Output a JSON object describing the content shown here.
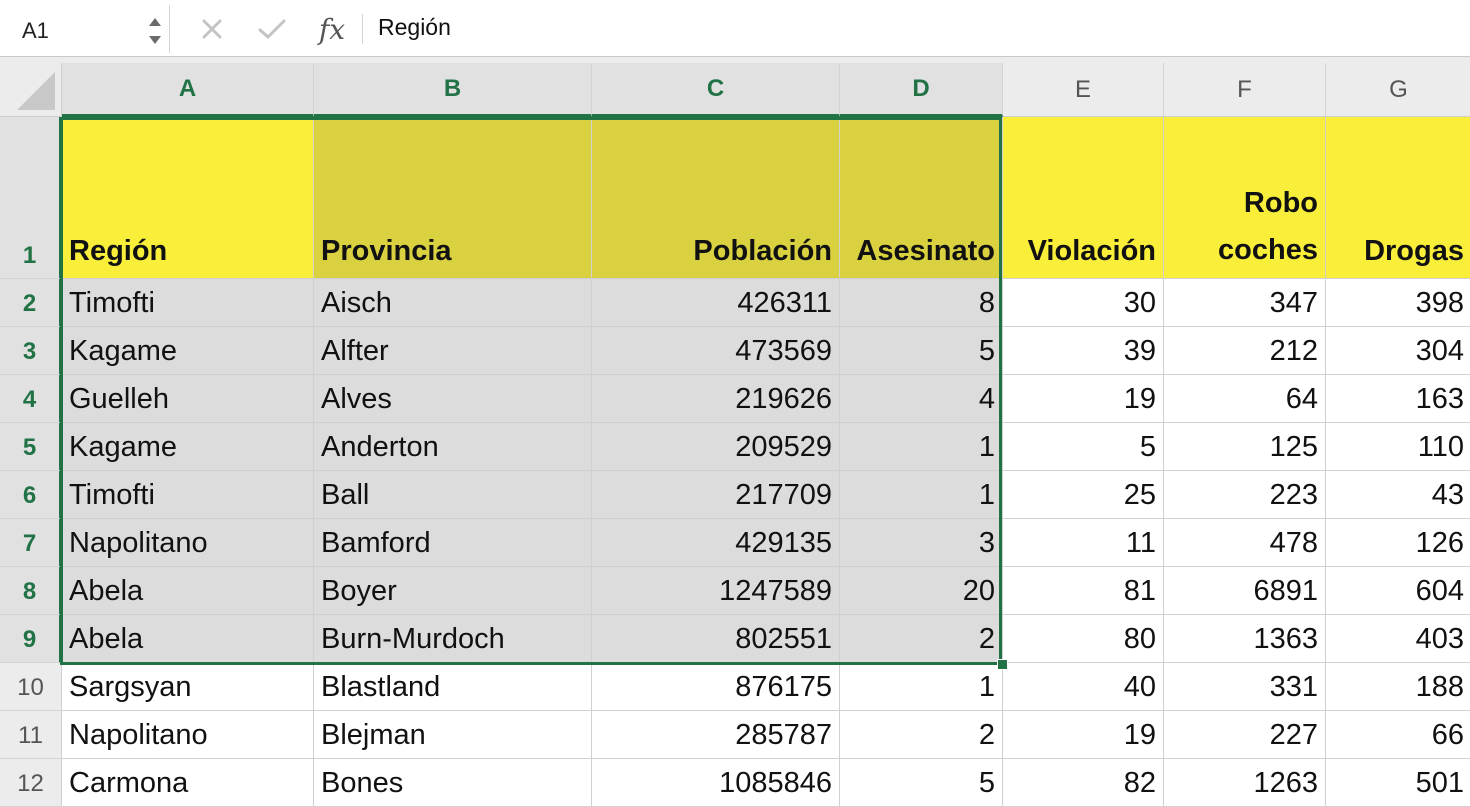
{
  "name_box": "A1",
  "formula": "Región",
  "formula_icons": {
    "cancel": "close-icon",
    "confirm": "check-icon",
    "function": "fx-icon"
  },
  "fx_label": "fx",
  "columns": [
    "A",
    "B",
    "C",
    "D",
    "E",
    "F",
    "G"
  ],
  "rows": [
    "1",
    "2",
    "3",
    "4",
    "5",
    "6",
    "7",
    "8",
    "9",
    "10",
    "11",
    "12"
  ],
  "selected_columns": [
    "A",
    "B",
    "C",
    "D"
  ],
  "selected_rows": [
    "1",
    "2",
    "3",
    "4",
    "5",
    "6",
    "7",
    "8",
    "9"
  ],
  "headers": [
    "Región",
    "Provincia",
    "Población",
    "Asesinato",
    "Violación",
    "Robo coches",
    "Drogas"
  ],
  "data": [
    [
      "Timofti",
      "Aisch",
      "426311",
      "8",
      "30",
      "347",
      "398"
    ],
    [
      "Kagame",
      "Alfter",
      "473569",
      "5",
      "39",
      "212",
      "304"
    ],
    [
      "Guelleh",
      "Alves",
      "219626",
      "4",
      "19",
      "64",
      "163"
    ],
    [
      "Kagame",
      "Anderton",
      "209529",
      "1",
      "5",
      "125",
      "110"
    ],
    [
      "Timofti",
      "Ball",
      "217709",
      "1",
      "25",
      "223",
      "43"
    ],
    [
      "Napolitano",
      "Bamford",
      "429135",
      "3",
      "11",
      "478",
      "126"
    ],
    [
      "Abela",
      "Boyer",
      "1247589",
      "20",
      "81",
      "6891",
      "604"
    ],
    [
      "Abela",
      "Burn-Murdoch",
      "802551",
      "2",
      "80",
      "1363",
      "403"
    ],
    [
      "Sargsyan",
      "Blastland",
      "876175",
      "1",
      "40",
      "331",
      "188"
    ],
    [
      "Napolitano",
      "Blejman",
      "285787",
      "2",
      "19",
      "227",
      "66"
    ],
    [
      "Carmona",
      "Bones",
      "1085846",
      "5",
      "82",
      "1263",
      "501"
    ]
  ],
  "colors": {
    "accent": "#217346",
    "header_fill": "#f9ef3a",
    "selected_header_fill": "#d9d13f",
    "selected_body_fill": "#dcdcdc"
  }
}
